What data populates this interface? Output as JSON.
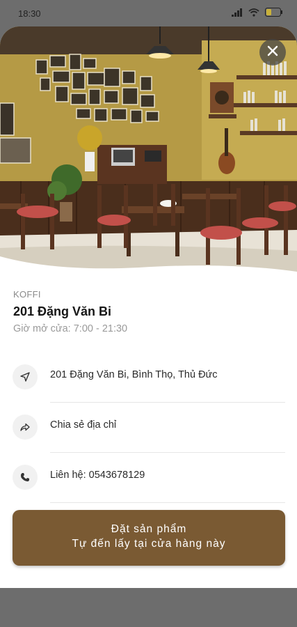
{
  "status_bar": {
    "time": "18:30",
    "battery": "31"
  },
  "store": {
    "brand": "KOFFI",
    "name": "201 Đặng Văn Bi",
    "hours": "Giờ mở cửa: 7:00 - 21:30"
  },
  "rows": [
    {
      "icon": "navigation-arrow-icon",
      "text": "201 Đặng Văn Bi, Bình Thọ, Thủ Đức"
    },
    {
      "icon": "share-icon",
      "text": "Chia sẻ địa chỉ"
    },
    {
      "icon": "phone-icon",
      "text": "Liên hệ: 0543678129"
    }
  ],
  "order_button": {
    "line1": "Đặt sản phẩm",
    "line2": "Tự đến lấy tại cửa hàng này"
  },
  "colors": {
    "accent": "#7a5a33",
    "wall": "#bfa548",
    "wood": "#5a3a24"
  }
}
